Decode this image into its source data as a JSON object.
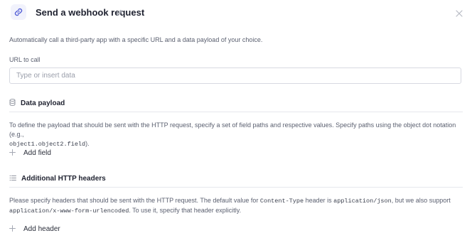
{
  "header": {
    "title": "Send a webhook request"
  },
  "intro": "Automatically call a third-party app with a specific URL and a data payload of your choice.",
  "url_field": {
    "label": "URL to call",
    "placeholder": "Type or insert data",
    "value": ""
  },
  "payload": {
    "title": "Data payload",
    "desc_1": "To define the payload that should be sent with the HTTP request, specify a set of field paths and respective values. Specify paths using the object dot notation (e.g.,",
    "code_example": "object1.object2.field",
    "desc_2": ").",
    "add_label": "Add field"
  },
  "headers_section": {
    "title": "Additional HTTP headers",
    "desc_1": "Please specify headers that should be sent with the HTTP request. The default value for ",
    "code_1": "Content-Type",
    "desc_2": " header is ",
    "code_2": "application/json",
    "desc_3": ", but we also support ",
    "code_3": "application/x-www-form-urlencoded",
    "desc_4": ". To use it, specify that header explicitly.",
    "add_label": "Add header"
  },
  "icons": {
    "link": "link-icon",
    "edit": "pencil-icon",
    "close": "close-icon",
    "payload": "database-icon",
    "headers": "list-icon",
    "add": "plus-icon"
  },
  "colors": {
    "accent": "#4f5bd5",
    "text": "#1f2230",
    "muted": "#5b6070",
    "border": "#d7d9e1"
  }
}
